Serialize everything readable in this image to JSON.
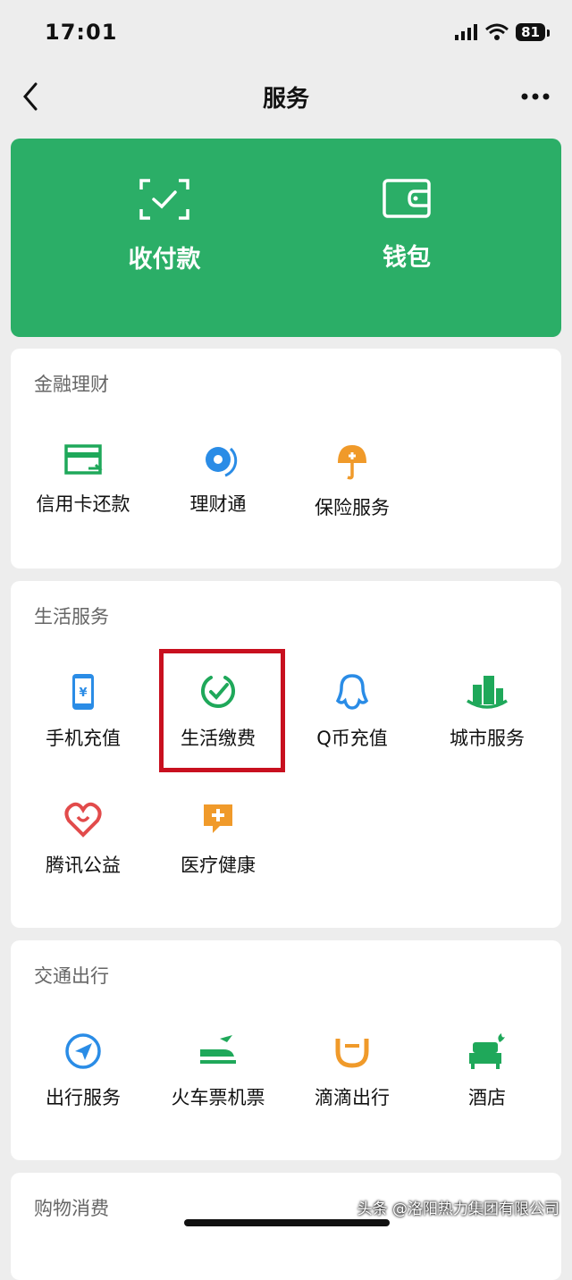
{
  "status_bar": {
    "time": "17:01",
    "battery": "81"
  },
  "nav": {
    "title": "服务",
    "back_icon": "chevron-left-icon",
    "more_icon": "more-dots-icon"
  },
  "pay_card": {
    "background": "#2bae67",
    "items": [
      {
        "label": "收付款",
        "icon": "scan-check-icon"
      },
      {
        "label": "钱包",
        "icon": "wallet-icon"
      }
    ]
  },
  "sections": [
    {
      "title": "金融理财",
      "items": [
        {
          "label": "信用卡还款",
          "icon": "credit-card-icon",
          "color": "#1fa85a"
        },
        {
          "label": "理财通",
          "icon": "wealth-icon",
          "color": "#2a8ce6"
        },
        {
          "label": "保险服务",
          "icon": "umbrella-icon",
          "color": "#f09a2a"
        }
      ]
    },
    {
      "title": "生活服务",
      "items": [
        {
          "label": "手机充值",
          "icon": "phone-icon",
          "color": "#2a8ce6"
        },
        {
          "label": "生活缴费",
          "icon": "check-circle-icon",
          "color": "#1fa85a",
          "highlighted": true
        },
        {
          "label": "Q币充值",
          "icon": "qq-penguin-icon",
          "color": "#2a8ce6"
        },
        {
          "label": "城市服务",
          "icon": "city-icon",
          "color": "#1fa85a"
        },
        {
          "label": "腾讯公益",
          "icon": "heart-icon",
          "color": "#e24b4b"
        },
        {
          "label": "医疗健康",
          "icon": "medical-icon",
          "color": "#f09a2a"
        }
      ]
    },
    {
      "title": "交通出行",
      "items": [
        {
          "label": "出行服务",
          "icon": "navigation-icon",
          "color": "#2a8ce6"
        },
        {
          "label": "火车票机票",
          "icon": "train-plane-icon",
          "color": "#1fa85a"
        },
        {
          "label": "滴滴出行",
          "icon": "didi-icon",
          "color": "#f09a2a"
        },
        {
          "label": "酒店",
          "icon": "hotel-bed-icon",
          "color": "#1fa85a"
        }
      ]
    },
    {
      "title": "购物消费",
      "items": []
    }
  ],
  "highlight_color": "#c8101f",
  "watermark": "头条 @洛阳热力集团有限公司"
}
